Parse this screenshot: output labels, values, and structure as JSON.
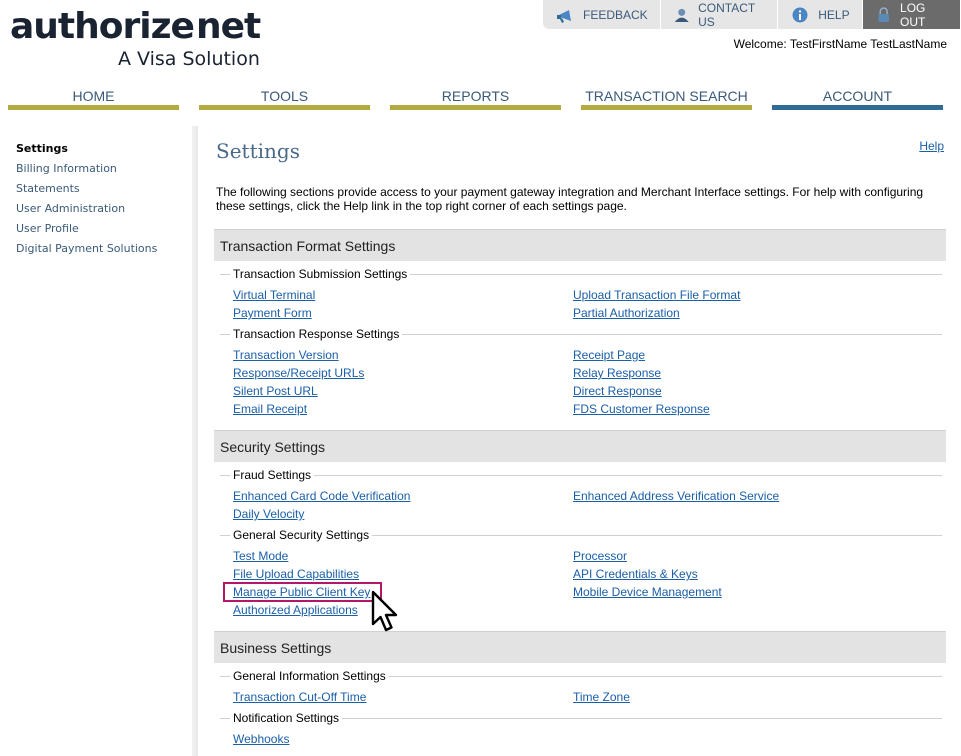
{
  "logo": {
    "text_a": "authorize",
    "text_b": "net",
    "tagline": "A Visa Solution"
  },
  "top_links": [
    {
      "label": "FEEDBACK",
      "icon": "megaphone-icon"
    },
    {
      "label": "CONTACT US",
      "icon": "person-icon"
    },
    {
      "label": "HELP",
      "icon": "info-icon"
    },
    {
      "label": "LOG OUT",
      "icon": "lock-icon"
    }
  ],
  "welcome": "Welcome: TestFirstName TestLastName",
  "nav": [
    "HOME",
    "TOOLS",
    "REPORTS",
    "TRANSACTION SEARCH",
    "ACCOUNT"
  ],
  "sidebar": [
    "Settings",
    "Billing Information",
    "Statements",
    "User Administration",
    "User Profile",
    "Digital Payment Solutions"
  ],
  "page": {
    "title": "Settings",
    "help": "Help",
    "intro": "The following sections provide access to your payment gateway integration and Merchant Interface settings. For help with configuring these settings, click the Help link in the top right corner of each settings page."
  },
  "sections": {
    "tfs": {
      "title": "Transaction Format Settings",
      "submission": {
        "title": "Transaction Submission Settings",
        "left": [
          "Virtual Terminal",
          "Payment Form"
        ],
        "right": [
          "Upload Transaction File Format",
          "Partial Authorization"
        ]
      },
      "response": {
        "title": "Transaction Response Settings",
        "left": [
          "Transaction Version",
          "Response/Receipt URLs",
          "Silent Post URL",
          "Email Receipt"
        ],
        "right": [
          "Receipt Page",
          "Relay Response",
          "Direct Response",
          "FDS Customer Response"
        ]
      }
    },
    "sec": {
      "title": "Security Settings",
      "fraud": {
        "title": "Fraud Settings",
        "left": [
          "Enhanced Card Code Verification",
          "Daily Velocity"
        ],
        "right": [
          "Enhanced Address Verification Service"
        ]
      },
      "general": {
        "title": "General Security Settings",
        "left": [
          "Test Mode",
          "File Upload Capabilities",
          "Manage Public Client Key",
          "Authorized Applications"
        ],
        "right": [
          "Processor",
          "API Credentials & Keys",
          "Mobile Device Management"
        ]
      }
    },
    "biz": {
      "title": "Business Settings",
      "info": {
        "title": "General Information Settings",
        "left": [
          "Transaction Cut-Off Time"
        ],
        "right": [
          "Time Zone"
        ]
      },
      "notif": {
        "title": "Notification Settings",
        "left": [
          "Webhooks"
        ]
      }
    }
  },
  "colors": {
    "nav_bar": "#b3ab3f",
    "nav_active": "#2f6b95",
    "link": "#1a5fa8",
    "highlight": "#b3176a"
  }
}
